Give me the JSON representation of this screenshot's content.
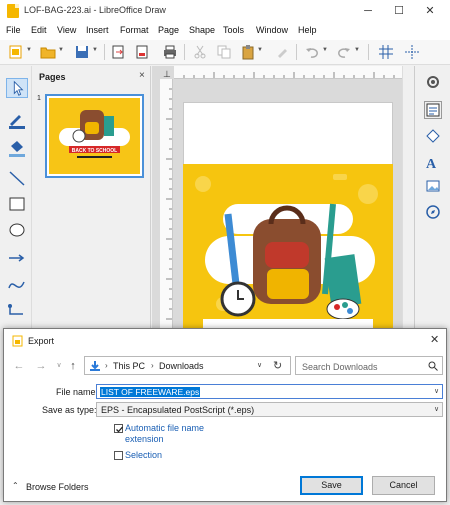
{
  "window": {
    "title": "LOF-BAG-223.ai - LibreOffice Draw",
    "minimize": "─",
    "maximize": "☐",
    "close": "✕"
  },
  "menu": [
    "File",
    "Edit",
    "View",
    "Insert",
    "Format",
    "Page",
    "Shape",
    "Tools",
    "Window",
    "Help"
  ],
  "pages_pane": {
    "title": "Pages",
    "close": "×",
    "page_number": "1"
  },
  "artwork": {
    "line1": "BACK TO SCHOOL"
  },
  "dialog": {
    "title": "Export",
    "close": "✕",
    "path": [
      "This PC",
      "Downloads"
    ],
    "search_placeholder": "Search Downloads",
    "file_name_label": "File name:",
    "file_name_value": "LIST OF FREEWARE.eps",
    "save_as_label": "Save as type:",
    "save_as_value": "EPS - Encapsulated PostScript (*.eps)",
    "auto_ext_label": "Automatic file name extension",
    "auto_ext_checked": true,
    "selection_label": "Selection",
    "selection_checked": false,
    "browse_folders": "Browse Folders",
    "save_label": "Save",
    "cancel_label": "Cancel"
  },
  "colors": {
    "accent": "#0078d7",
    "art_yellow": "#f6c50f",
    "link_blue": "#1a5fb4"
  }
}
